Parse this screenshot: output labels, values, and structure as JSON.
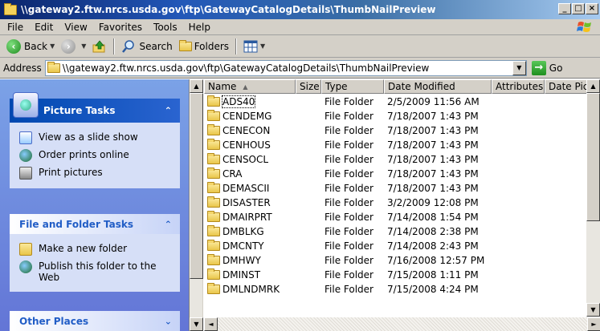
{
  "window": {
    "title": "\\\\gateway2.ftw.nrcs.usda.gov\\ftp\\GatewayCatalogDetails\\ThumbNailPreview",
    "min_label": "_",
    "max_label": "□",
    "close_label": "×"
  },
  "menu": {
    "items": [
      "File",
      "Edit",
      "View",
      "Favorites",
      "Tools",
      "Help"
    ]
  },
  "toolbar": {
    "back_label": "Back",
    "search_label": "Search",
    "folders_label": "Folders"
  },
  "address": {
    "label": "Address",
    "value": "\\\\gateway2.ftw.nrcs.usda.gov\\ftp\\GatewayCatalogDetails\\ThumbNailPreview",
    "go_label": "Go"
  },
  "task_pane": {
    "picture_tasks": {
      "title": "Picture Tasks",
      "links": [
        "View as a slide show",
        "Order prints online",
        "Print pictures"
      ]
    },
    "file_folder_tasks": {
      "title": "File and Folder Tasks",
      "links": [
        "Make a new folder",
        "Publish this folder to the Web"
      ]
    },
    "other_places": {
      "title": "Other Places"
    }
  },
  "file_list": {
    "columns": [
      "Name",
      "Size",
      "Type",
      "Date Modified",
      "Attributes",
      "Date Pict"
    ],
    "rows": [
      {
        "name": "ADS40",
        "type": "File Folder",
        "date": "2/5/2009 11:56 AM"
      },
      {
        "name": "CENDEMG",
        "type": "File Folder",
        "date": "7/18/2007 1:43 PM"
      },
      {
        "name": "CENECON",
        "type": "File Folder",
        "date": "7/18/2007 1:43 PM"
      },
      {
        "name": "CENHOUS",
        "type": "File Folder",
        "date": "7/18/2007 1:43 PM"
      },
      {
        "name": "CENSOCL",
        "type": "File Folder",
        "date": "7/18/2007 1:43 PM"
      },
      {
        "name": "CRA",
        "type": "File Folder",
        "date": "7/18/2007 1:43 PM"
      },
      {
        "name": "DEMASCII",
        "type": "File Folder",
        "date": "7/18/2007 1:43 PM"
      },
      {
        "name": "DISASTER",
        "type": "File Folder",
        "date": "3/2/2009 12:08 PM"
      },
      {
        "name": "DMAIRPRT",
        "type": "File Folder",
        "date": "7/14/2008 1:54 PM"
      },
      {
        "name": "DMBLKG",
        "type": "File Folder",
        "date": "7/14/2008 2:38 PM"
      },
      {
        "name": "DMCNTY",
        "type": "File Folder",
        "date": "7/14/2008 2:43 PM"
      },
      {
        "name": "DMHWY",
        "type": "File Folder",
        "date": "7/16/2008 12:57 PM"
      },
      {
        "name": "DMINST",
        "type": "File Folder",
        "date": "7/15/2008 1:11 PM"
      },
      {
        "name": "DMLNDMRK",
        "type": "File Folder",
        "date": "7/15/2008 4:24 PM"
      }
    ]
  }
}
